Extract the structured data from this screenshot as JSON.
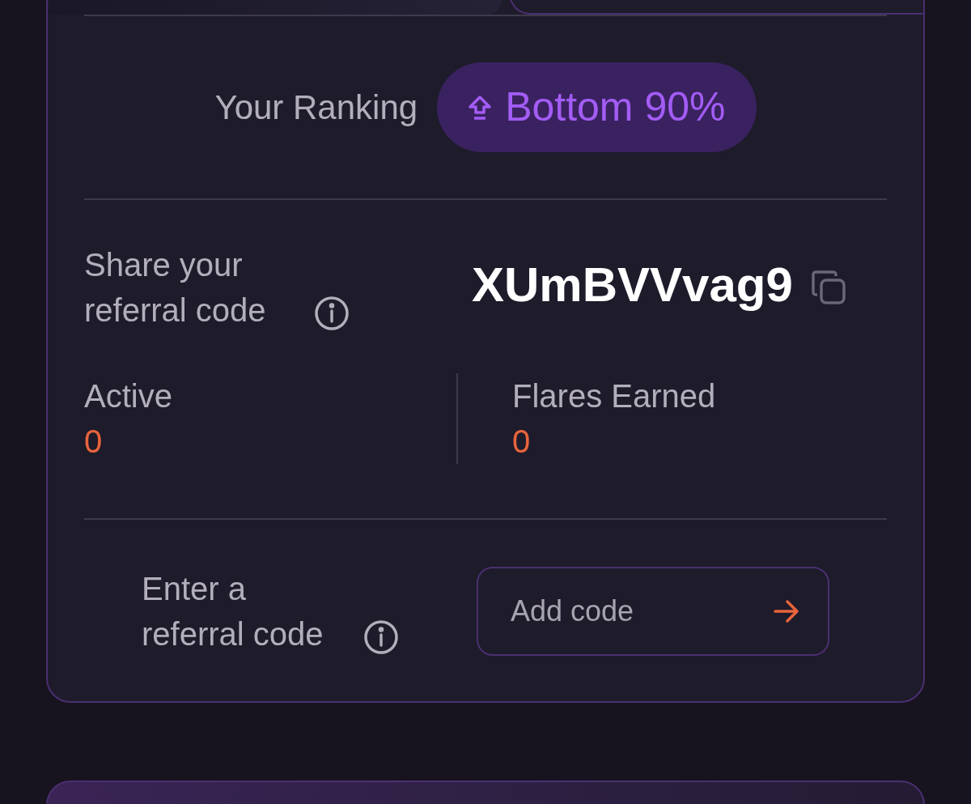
{
  "ranking": {
    "label": "Your Ranking",
    "badge": "Bottom 90%"
  },
  "referral": {
    "label": "Share your referral code",
    "code": "XUmBVVvag9"
  },
  "stats": [
    {
      "label": "Active",
      "value": "0"
    },
    {
      "label": "Flares Earned",
      "value": "0"
    }
  ],
  "enter_code": {
    "label": "Enter a referral code",
    "placeholder": "Add code"
  }
}
